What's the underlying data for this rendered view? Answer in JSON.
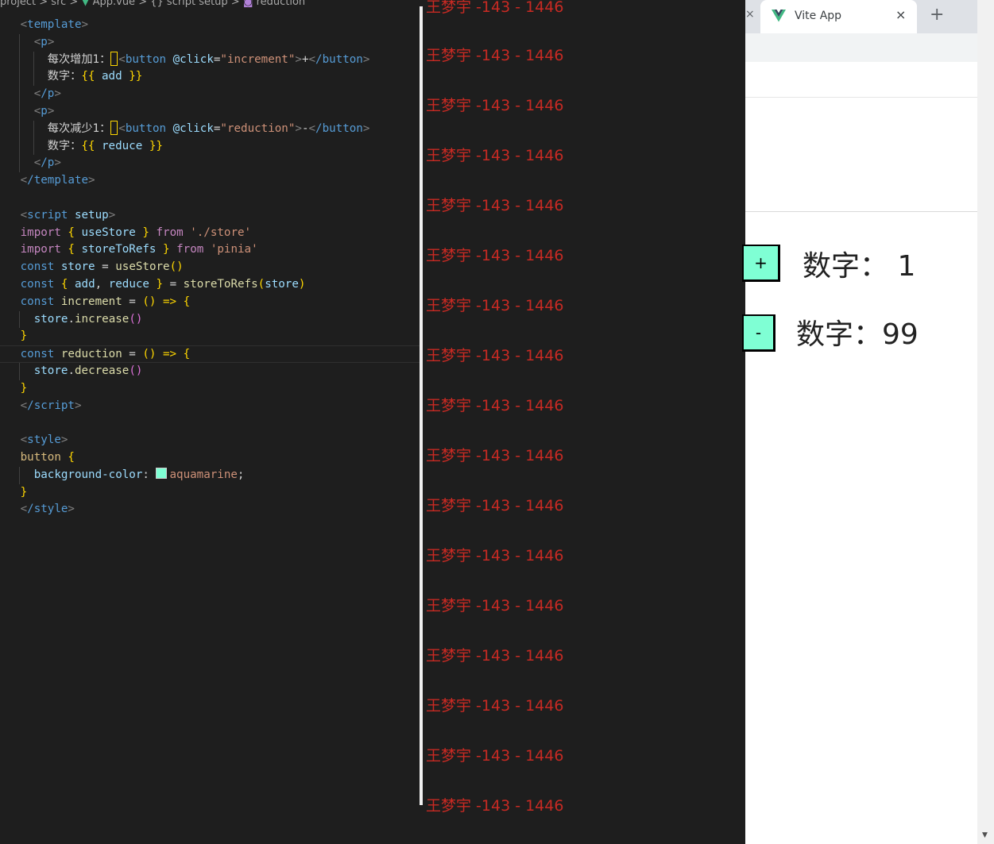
{
  "breadcrumb": {
    "project": "project",
    "sep": " > ",
    "src": "src",
    "file": "App.vue",
    "section": "script setup",
    "symbol": "reduction"
  },
  "code": {
    "template_open": "template",
    "p": "p",
    "p_close": "/p",
    "increment_text": "每次增加1：",
    "button": "button",
    "click_attr": "@click",
    "increment_handler": "\"increment\"",
    "plus": "+",
    "button_close": "/button",
    "num_label": "数字：",
    "mustache_open": "{{",
    "mustache_close": "}}",
    "add": "add",
    "reduce_text": "每次减少1：",
    "reduction_handler": "\"reduction\"",
    "minus": "-",
    "reduce": "reduce",
    "template_close": "/template",
    "script_open": "script",
    "setup": "setup",
    "import": "import",
    "useStore": "useStore",
    "from": "from",
    "store_path": "'./store'",
    "storeToRefs": "storeToRefs",
    "pinia": "'pinia'",
    "const": "const",
    "store": "store",
    "eq": " = ",
    "useStore_call": "useStore",
    "increment": "increment",
    "arrow": "() => ",
    "increase": "increase",
    "reduction": "reduction",
    "decrease": "decrease",
    "script_close": "/script",
    "style_open": "style",
    "button_sel": "button",
    "bg_prop": "background-color",
    "bg_val": "aquamarine",
    "style_close": "/style"
  },
  "watermark": {
    "text": "王梦宇 -143 - 1446",
    "count": 17
  },
  "browser": {
    "tab_title": "Vite App",
    "tab_close": "×",
    "prev_close": "×",
    "new_tab": "+",
    "plus_label": "+",
    "minus_label": "-",
    "add_display": "数字：  1",
    "reduce_display": "数字：99",
    "scroll_arrow": "▼"
  },
  "colors": {
    "button_bg": "#7fffd4",
    "watermark": "#c82a23",
    "editor_bg": "#1e1e1e"
  }
}
